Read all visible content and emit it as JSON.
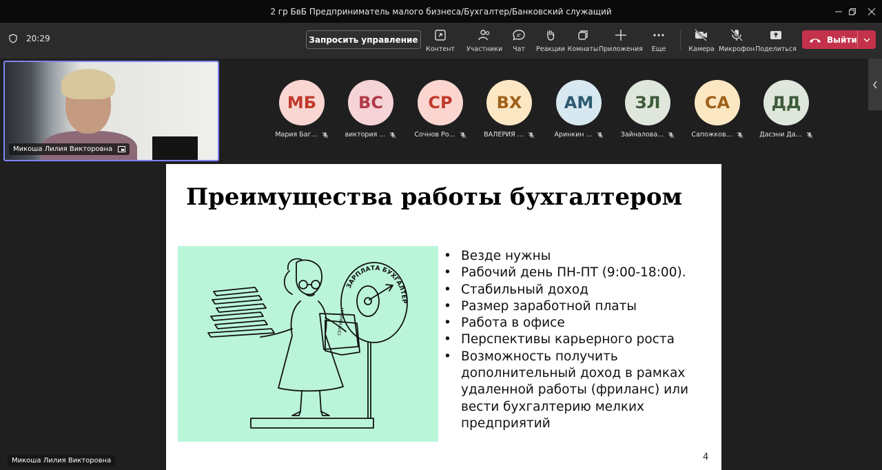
{
  "window": {
    "title": "2 гр БвБ Предприниматель малого бизнеса/Бухгалтер/Банковский служащий",
    "controls": [
      "minimize",
      "restore",
      "close"
    ]
  },
  "toolbar": {
    "timer": "20:29",
    "request_control": "Запросить управление",
    "items": [
      {
        "id": "content",
        "label": "Контент",
        "icon": "share-content-icon"
      },
      {
        "id": "participants",
        "label": "Участники",
        "icon": "people-icon"
      },
      {
        "id": "chat",
        "label": "Чат",
        "icon": "chat-icon"
      },
      {
        "id": "reactions",
        "label": "Реакции",
        "icon": "hand-icon"
      },
      {
        "id": "rooms",
        "label": "Комнаты",
        "icon": "rooms-icon"
      },
      {
        "id": "apps",
        "label": "Приложения",
        "icon": "plus-icon"
      },
      {
        "id": "more",
        "label": "Еще",
        "icon": "more-icon"
      },
      {
        "id": "camera",
        "label": "Камера",
        "icon": "camera-off-icon"
      },
      {
        "id": "mic",
        "label": "Микрофон",
        "icon": "mic-off-icon"
      },
      {
        "id": "share",
        "label": "Поделиться",
        "icon": "share-icon"
      }
    ],
    "leave_label": "Выйти",
    "leave_color": "#c4314b"
  },
  "self_video": {
    "name": "Микоша Лилия Викторовна",
    "border_color": "#7f85f5"
  },
  "participants": [
    {
      "initials": "МБ",
      "name": "Мария Баг...",
      "bg": "#f9d6d2",
      "fg": "#c0392b"
    },
    {
      "initials": "ВС",
      "name": "виктория ...",
      "bg": "#f6d3d6",
      "fg": "#b03a48"
    },
    {
      "initials": "СР",
      "name": "Сочнов Ро...",
      "bg": "#fbd5cf",
      "fg": "#c0392b"
    },
    {
      "initials": "ВХ",
      "name": "ВАЛЕРИЯ ...",
      "bg": "#fbe7c3",
      "fg": "#a0611a"
    },
    {
      "initials": "АМ",
      "name": "Аринкин ...",
      "bg": "#d8e8f0",
      "fg": "#2d5a70"
    },
    {
      "initials": "ЗЛ",
      "name": "Зайналова...",
      "bg": "#dfe6dc",
      "fg": "#3d5a3a"
    },
    {
      "initials": "СА",
      "name": "Сапожков...",
      "bg": "#fbe8c3",
      "fg": "#a0611a"
    },
    {
      "initials": "ДД",
      "name": "Дасэни Да...",
      "bg": "#dfe6dc",
      "fg": "#3d5a3a"
    }
  ],
  "slide": {
    "title": "Преимущества работы бухгалтером",
    "illustration_text": "ЗАРПЛАТА БУХГАЛТЕРА",
    "illustration_bg": "#baf5d9",
    "bullets": [
      "Везде нужны",
      "Рабочий день ПН-ПТ (9:00-18:00).",
      "Стабильный доход",
      "Размер заработной платы",
      "Работа в офисе",
      "Перспективы карьерного роста",
      "Возможность получить дополнительный доход в рамках удаленной работы (фриланс) или вести бухгалтерию мелких предприятий"
    ],
    "page_number": "4"
  },
  "presenter": {
    "name": "Микоша Лилия Викторовна"
  }
}
